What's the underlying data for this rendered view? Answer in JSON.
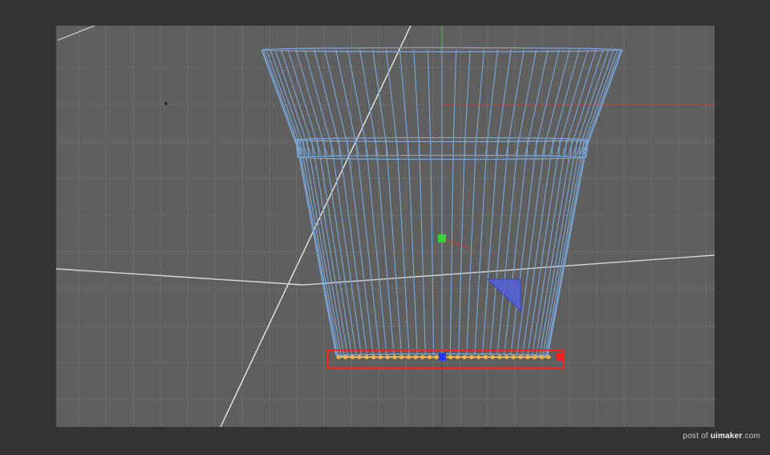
{
  "viewport": {
    "name": "3d-viewport",
    "mode": "point-selection",
    "colors": {
      "outer_bg": "#333333",
      "viewport_bg": "#5f5f5f",
      "grid": "#6b6b6b",
      "wire": "#7aa6d6",
      "world_x_axis": "#d23b3b",
      "world_y_axis": "#3ccf3c",
      "selection_box": "#ff2020",
      "selected_points": "#f2b04a",
      "axis_handle_z": "#2233ff",
      "axis_handle_x": "#ff2020"
    }
  },
  "model": {
    "object": "flower-pot-wireframe",
    "selected_ring": "bottom-points"
  },
  "watermark": {
    "prefix": "post of",
    "brand": "uimaker",
    "suffix": ".com"
  }
}
